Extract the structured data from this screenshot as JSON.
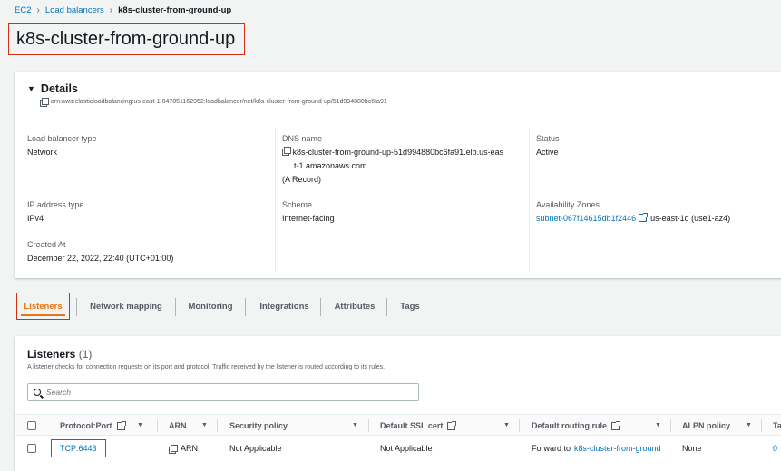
{
  "breadcrumb": {
    "items": [
      "EC2",
      "Load balancers"
    ],
    "current": "k8s-cluster-from-ground-up"
  },
  "page_title": "k8s-cluster-from-ground-up",
  "details": {
    "header": "Details",
    "arn": "arn:aws:elasticloadbalancing:us-east-1:047051162952:loadbalancer/net/k8s-cluster-from-ground-up/51d994880bc6fa91",
    "lb_type": {
      "label": "Load balancer type",
      "value": "Network"
    },
    "dns": {
      "label": "DNS name",
      "value_line1": "k8s-cluster-from-ground-up-51d994880bc6fa91.elb.us-eas",
      "value_line2": "t-1.amazonaws.com",
      "record": "(A Record)"
    },
    "status": {
      "label": "Status",
      "value": "Active"
    },
    "ip_type": {
      "label": "IP address type",
      "value": "IPv4"
    },
    "scheme": {
      "label": "Scheme",
      "value": "Internet-facing"
    },
    "az": {
      "label": "Availability Zones",
      "subnet": "subnet-067f14615db1f2446",
      "zone": "us-east-1d (use1-az4)"
    },
    "created": {
      "label": "Created At",
      "value": "December 22, 2022, 22:40 (UTC+01:00)"
    }
  },
  "tabs": [
    "Listeners",
    "Network mapping",
    "Monitoring",
    "Integrations",
    "Attributes",
    "Tags"
  ],
  "listeners": {
    "title": "Listeners",
    "count": "(1)",
    "description": "A listener checks for connection requests on its port and protocol. Traffic received by the listener is routed according to its rules.",
    "search_placeholder": "Search",
    "columns": [
      "Protocol:Port",
      "ARN",
      "Security policy",
      "Default SSL cert",
      "Default routing rule",
      "ALPN policy",
      "Ta"
    ],
    "row": {
      "protocol_port": "TCP:6443",
      "arn": "ARN",
      "security_policy": "Not Applicable",
      "ssl_cert": "Not Applicable",
      "routing_prefix": "Forward to",
      "routing_target": "k8s-cluster-from-ground",
      "alpn": "None",
      "tags": "0"
    }
  }
}
